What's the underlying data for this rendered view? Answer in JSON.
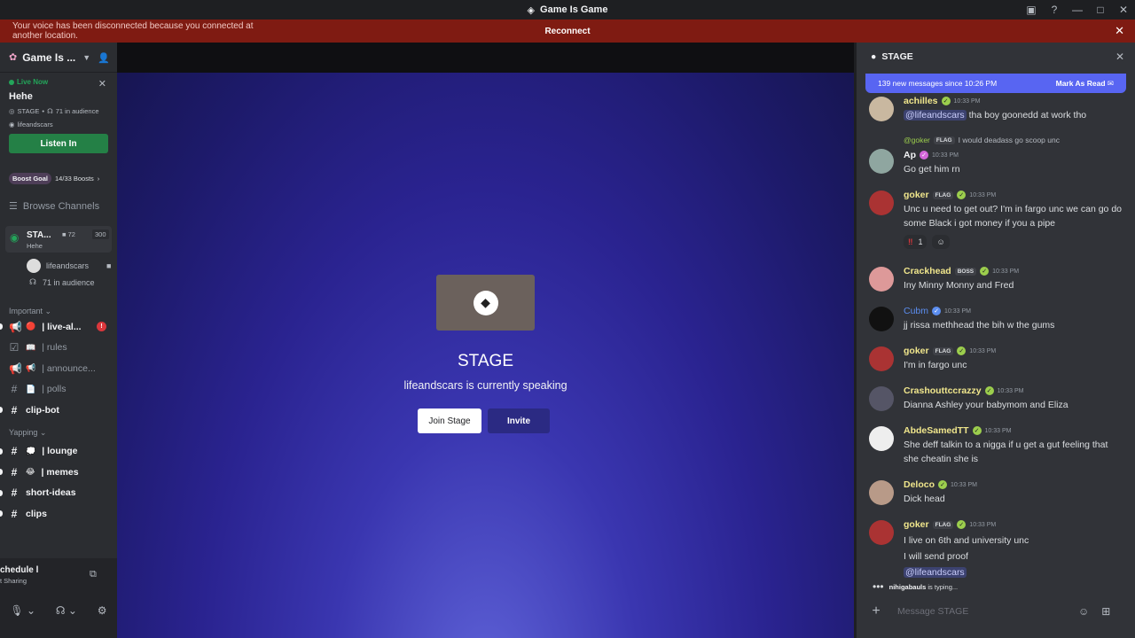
{
  "window": {
    "title": "Game Is Game"
  },
  "banner": {
    "message": "Your voice has been disconnected because you connected at another location.",
    "action": "Reconnect"
  },
  "guild": {
    "name": "Game Is ..."
  },
  "live": {
    "label": "Live Now",
    "title": "Hehe",
    "type": "STAGE",
    "audience": "71 in audience",
    "host": "lifeandscars",
    "listen": "Listen In"
  },
  "boost": {
    "goal": "Boost Goal",
    "progress": "14/33 Boosts"
  },
  "browse": "Browse Channels",
  "stage_channel": {
    "name": "STA...",
    "topic": "Hehe",
    "count": "72",
    "capacity": "300",
    "user": "lifeandscars",
    "audience": "71 in audience"
  },
  "categories": {
    "important": "Important",
    "yapping": "Yapping"
  },
  "channels_important": [
    {
      "emoji": "🔴",
      "label": "| live-al...",
      "badge": "!"
    },
    {
      "emoji": "📖",
      "label": "| rules"
    },
    {
      "emoji": "📢",
      "label": "| announce..."
    },
    {
      "emoji": "📄",
      "label": "| polls"
    },
    {
      "emoji": "",
      "label": "clip-bot"
    }
  ],
  "channels_yapping": [
    {
      "emoji": "💭",
      "label": "| lounge"
    },
    {
      "emoji": "😂",
      "label": "| memes"
    },
    {
      "emoji": "",
      "label": "short-ideas"
    },
    {
      "emoji": "",
      "label": "clips"
    }
  ],
  "user_panel": {
    "status": "chedule l",
    "sub": "t Sharing"
  },
  "stage": {
    "name": "STAGE",
    "speaking": "lifeandscars is currently speaking",
    "join": "Join Stage",
    "invite": "Invite"
  },
  "chat": {
    "title": "STAGE",
    "new_messages": "139 new messages since 10:26 PM",
    "mark_read": "Mark As Read",
    "messages": [
      {
        "author": "achilles",
        "color": "#f0e68c",
        "time": "10:33 PM",
        "mention": "@lifeandscars",
        "text": "tha boy goonedd at work tho"
      },
      {
        "reply_to": "@goker",
        "reply_tag": "FLAG",
        "reply_text": "I would deadass go scoop unc",
        "author": "Ap",
        "color": "#f2f3f5",
        "time": "10:33 PM",
        "text": "Go get him rn"
      },
      {
        "author": "goker",
        "tag": "FLAG",
        "color": "#f0e68c",
        "time": "10:33 PM",
        "text": "Unc u need to get out? I'm in fargo unc we can go do some Black i got money if you a pipe",
        "reaction": "1"
      },
      {
        "author": "Crackhead",
        "tag": "BOSS",
        "color": "#f0e68c",
        "time": "10:33 PM",
        "text": "Iny Minny Monny and Fred"
      },
      {
        "author": "Cubm",
        "color": "#5c8ef0",
        "time": "10:33 PM",
        "text": "jj rissa methhead the bih w the gums"
      },
      {
        "author": "goker",
        "tag": "FLAG",
        "color": "#f0e68c",
        "time": "10:33 PM",
        "text": "I'm in fargo unc"
      },
      {
        "author": "Crashouttccrazzy",
        "color": "#f0e68c",
        "time": "10:33 PM",
        "text": "Dianna Ashley your babymom and Eliza"
      },
      {
        "author": "AbdeSamedTT",
        "color": "#f0e68c",
        "time": "10:33 PM",
        "text": "She deff talkin to a nigga if u get a gut feeling that she cheatin she is"
      },
      {
        "author": "Deloco",
        "color": "#f0e68c",
        "time": "10:33 PM",
        "text": "Dick head"
      },
      {
        "author": "goker",
        "tag": "FLAG",
        "color": "#f0e68c",
        "time": "10:33 PM",
        "text": "I live on 6th and university unc",
        "text2": "I will send proof",
        "mention": "@lifeandscars"
      }
    ],
    "typing_user": "nihigabauls",
    "typing_suffix": "is typing...",
    "placeholder": "Message STAGE"
  }
}
